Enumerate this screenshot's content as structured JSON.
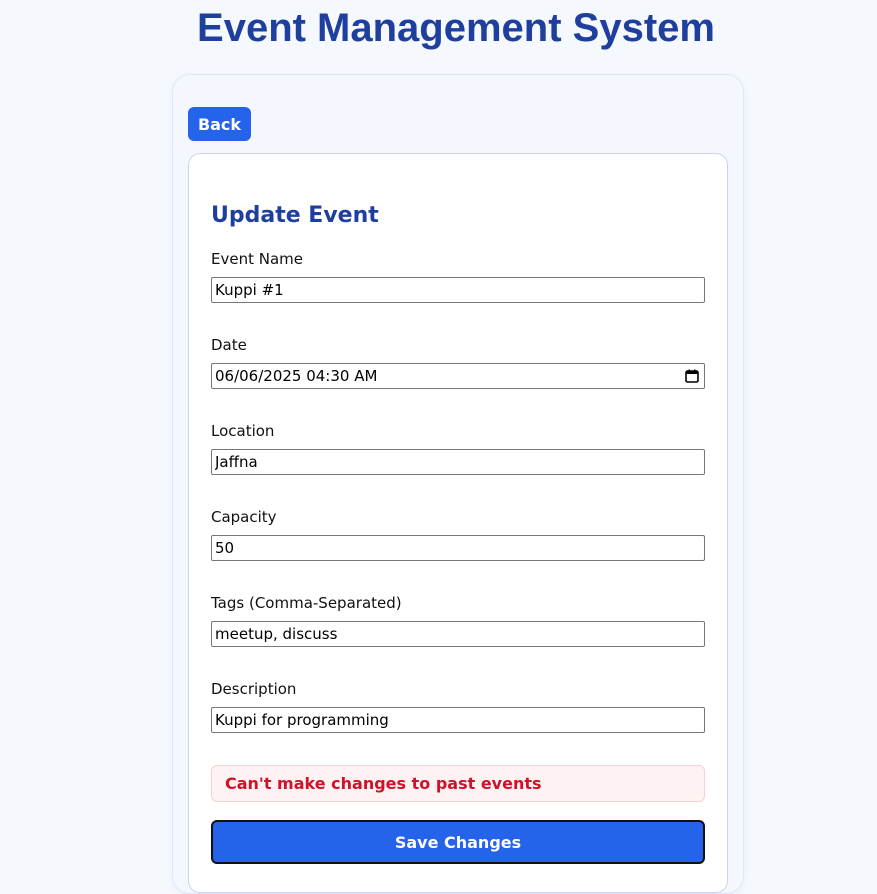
{
  "app": {
    "title": "Event Management System"
  },
  "nav": {
    "back_label": "Back"
  },
  "form": {
    "title": "Update Event",
    "fields": {
      "event_name": {
        "label": "Event Name",
        "value": "Kuppi #1"
      },
      "date": {
        "label": "Date",
        "value": "06/06/2025 04:30 AM",
        "icon": "calendar-icon"
      },
      "location": {
        "label": "Location",
        "value": "Jaffna"
      },
      "capacity": {
        "label": "Capacity",
        "value": "50"
      },
      "tags": {
        "label": "Tags (Comma-Separated)",
        "value": "meetup, discuss"
      },
      "description": {
        "label": "Description",
        "value": "Kuppi for programming"
      }
    },
    "error_message": "Can't make changes to past events",
    "submit_label": "Save Changes"
  },
  "colors": {
    "accent": "#2563eb",
    "heading": "#1f3f9f",
    "error": "#d1102a",
    "error_bg": "#fef2f2",
    "page_bg": "#f5f8fd"
  }
}
